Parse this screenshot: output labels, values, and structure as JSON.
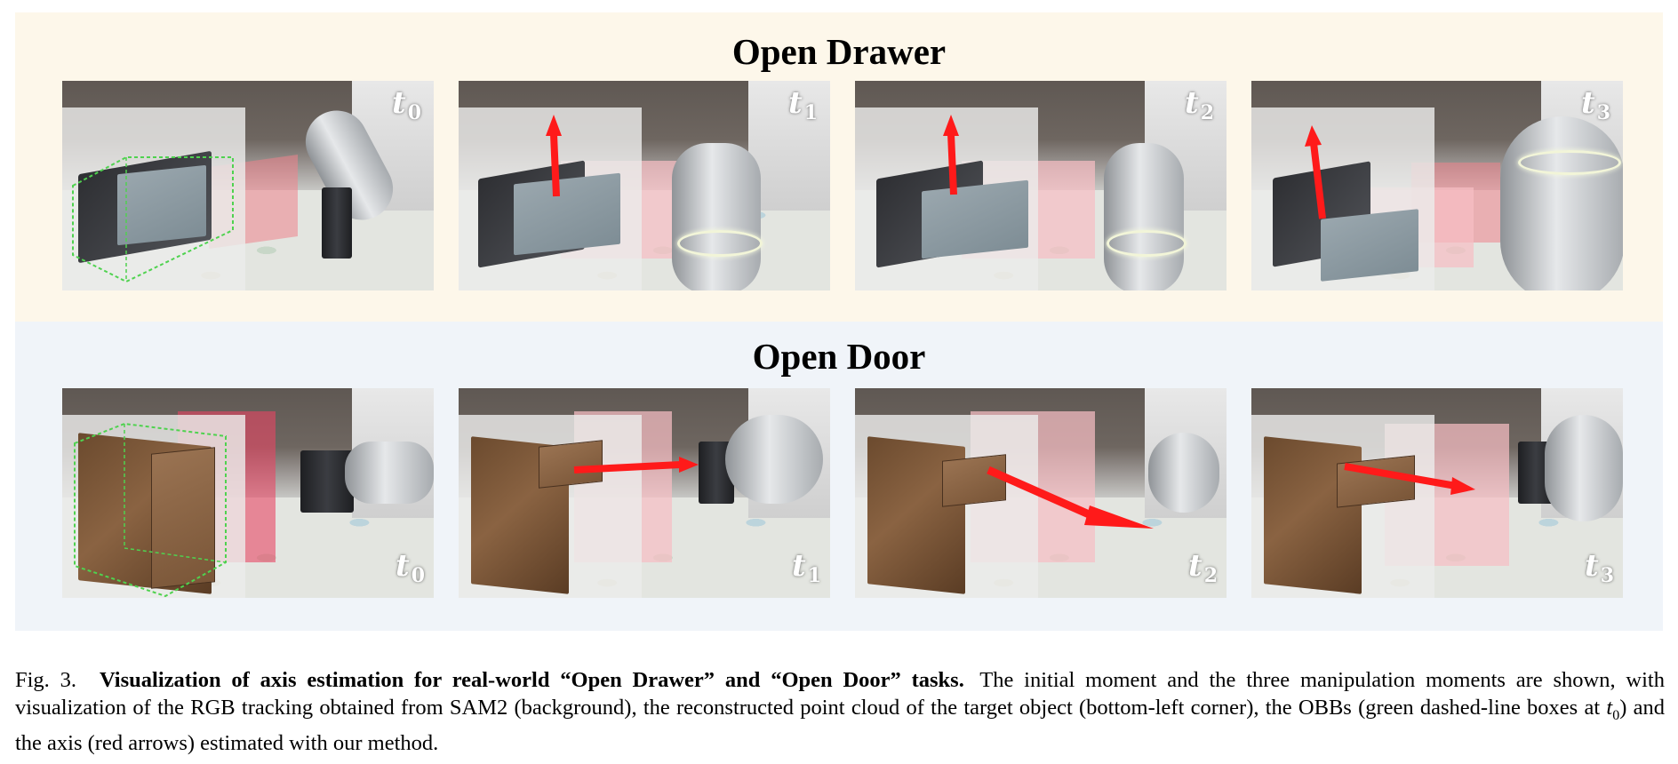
{
  "panels": {
    "drawer": {
      "title": "Open Drawer"
    },
    "door": {
      "title": "Open Door"
    }
  },
  "time_labels": [
    {
      "var": "t",
      "sub": "0"
    },
    {
      "var": "t",
      "sub": "1"
    },
    {
      "var": "t",
      "sub": "2"
    },
    {
      "var": "t",
      "sub": "3"
    }
  ],
  "caption": {
    "fig_num": "Fig. 3.",
    "title": "Visualization of axis estimation for real-world “Open Drawer” and “Open Door” tasks.",
    "body_before": "The initial moment and the three manipulation moments are shown, with visualization of the RGB tracking obtained from SAM2 (background), the reconstructed point cloud of the target object (bottom-left corner), the OBBs (green dashed-line boxes at",
    "time_var": "t",
    "time_sub": "0",
    "body_after": ") and the axis (red arrows) estimated with our method."
  },
  "colors": {
    "axis_arrow": "#ff1a1a",
    "obb_box": "#4fd24f",
    "drawer_panel_bg": "#fdf7ea",
    "door_panel_bg": "#f0f4f9"
  }
}
